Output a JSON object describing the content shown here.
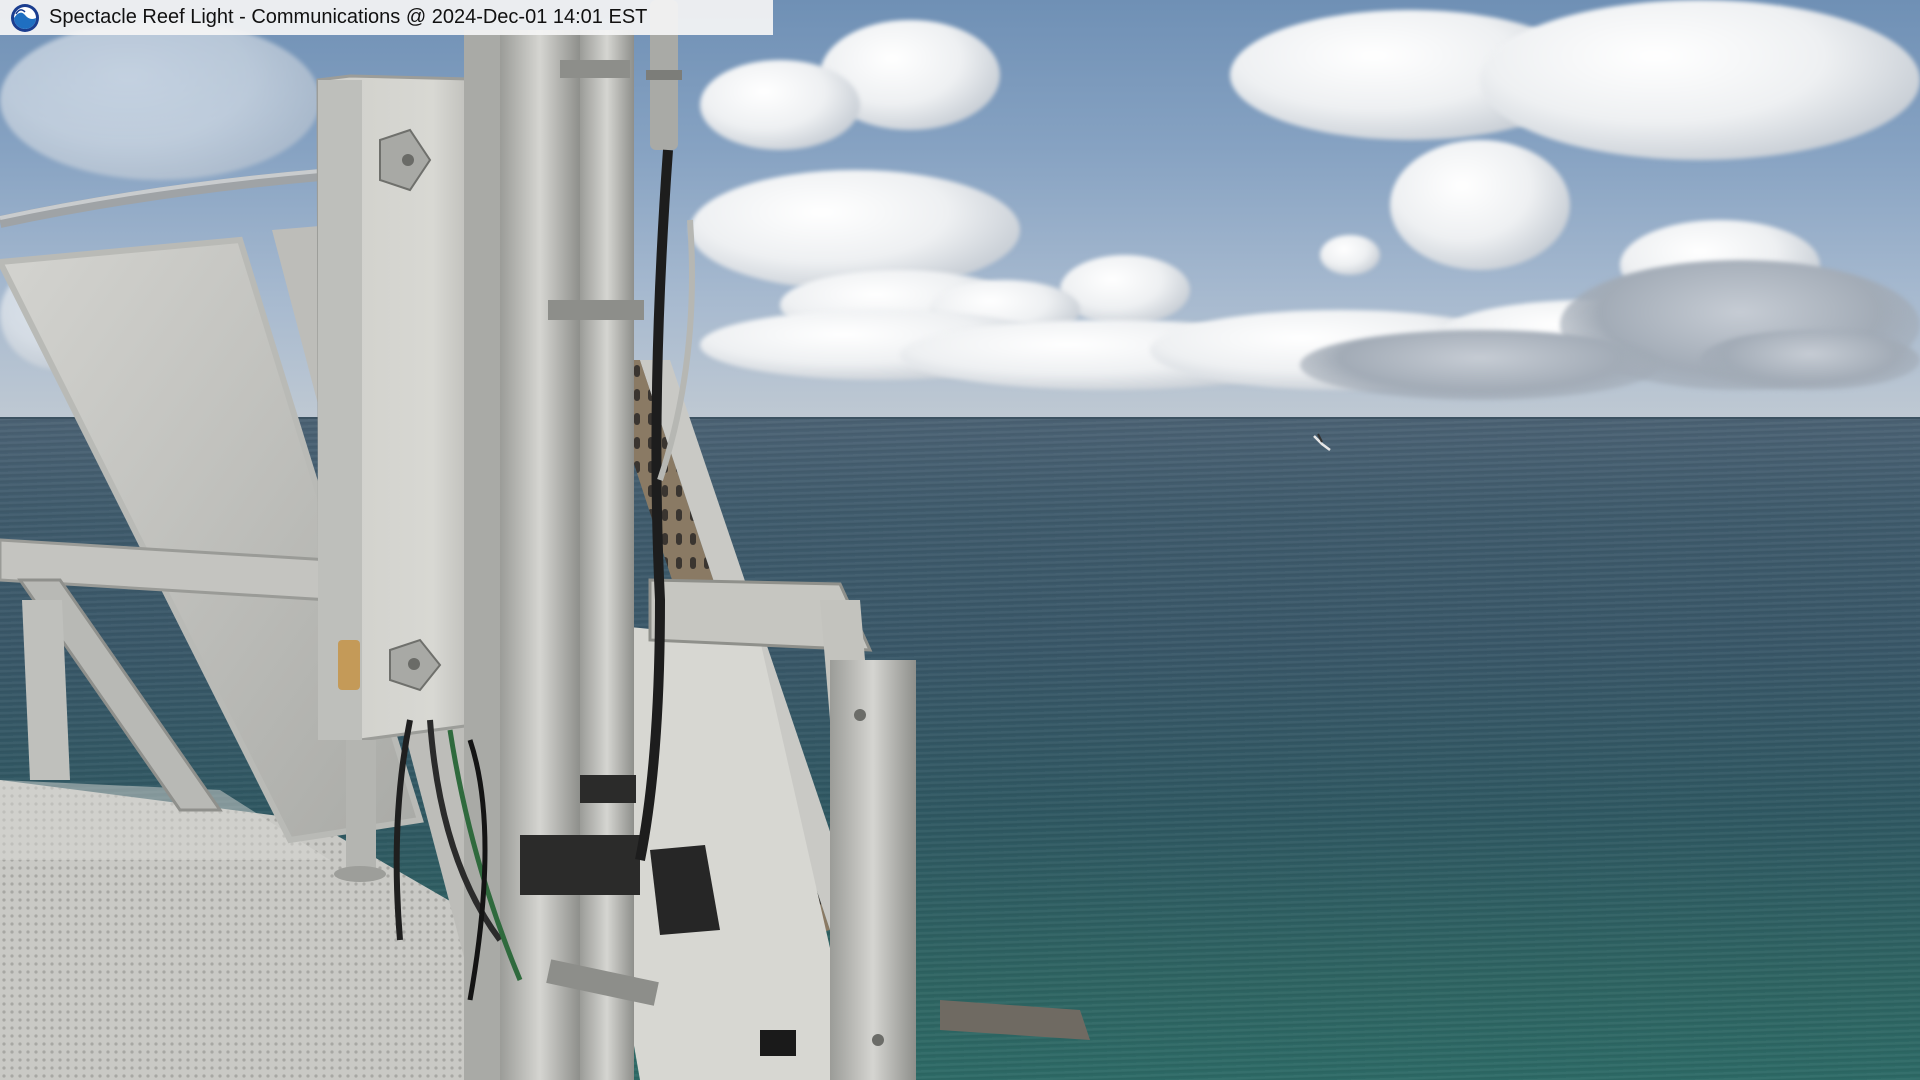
{
  "overlay": {
    "title": "Spectacle Reef Light - Communications @ 2024-Dec-01 14:01 EST",
    "logo_icon": "noaa-logo-icon"
  },
  "scene": {
    "description_icons": [
      "solar-panel",
      "equipment-enclosure",
      "antenna-mast",
      "railing",
      "grated-deck",
      "seagull"
    ],
    "colors": {
      "sky": "#86a2c2",
      "clouds": "#eef0f2",
      "water": "#395768",
      "metal": "#c8c8c4"
    }
  }
}
